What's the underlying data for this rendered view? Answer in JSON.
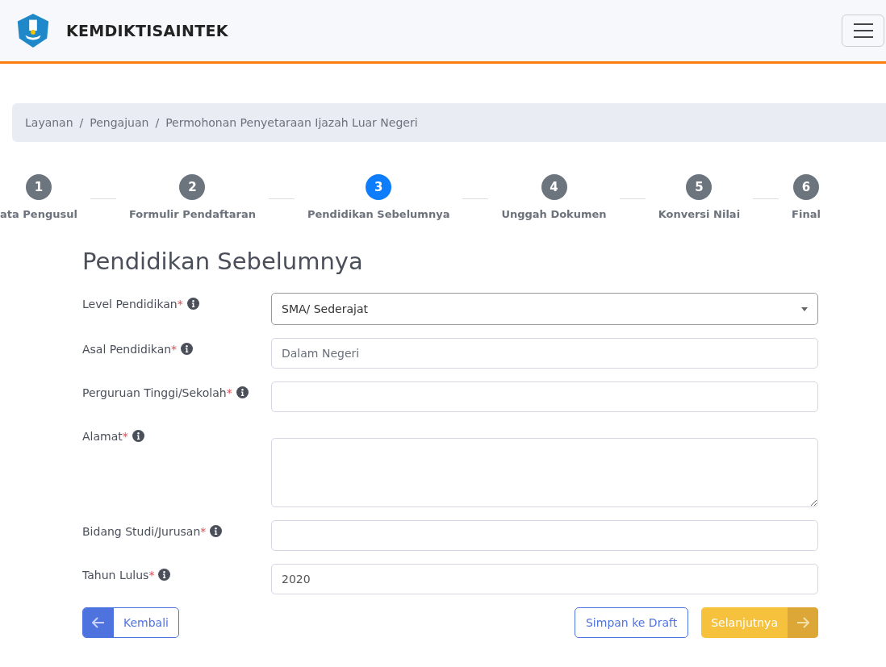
{
  "header": {
    "brand": "KEMDIKTISAINTEK"
  },
  "breadcrumb": {
    "separator": "/",
    "items": [
      "Layanan",
      "Pengajuan",
      "Permohonan Penyetaraan Ijazah Luar Negeri"
    ]
  },
  "steps": [
    {
      "number": "1",
      "label": "ata Pengusul",
      "selected": false
    },
    {
      "number": "2",
      "label": "Formulir Pendaftaran",
      "selected": false
    },
    {
      "number": "3",
      "label": "Pendidikan Sebelumnya",
      "selected": true
    },
    {
      "number": "4",
      "label": "Unggah Dokumen",
      "selected": false
    },
    {
      "number": "5",
      "label": "Konversi Nilai",
      "selected": false
    },
    {
      "number": "6",
      "label": "Final",
      "selected": false
    }
  ],
  "form": {
    "title": "Pendidikan Sebelumnya",
    "required_mark": "*",
    "fields": [
      {
        "label": "Level Pendidikan",
        "required": true,
        "kind": "select",
        "value": "SMA/ Sederajat"
      },
      {
        "label": "Asal Pendidikan",
        "required": true,
        "kind": "input",
        "value": "Dalam Negeri",
        "disabled": true
      },
      {
        "label": "Perguruan Tinggi/Sekolah",
        "required": true,
        "kind": "input"
      },
      {
        "label": "Alamat",
        "required": true,
        "kind": "textarea"
      },
      {
        "label": "Bidang Studi/Jurusan",
        "required": true,
        "kind": "input"
      },
      {
        "label": "Tahun Lulus",
        "required": true,
        "kind": "input",
        "value": "2020"
      }
    ]
  },
  "buttons": {
    "back": "Kembali",
    "draft": "Simpan ke Draft",
    "next": "Selanjutnya"
  }
}
